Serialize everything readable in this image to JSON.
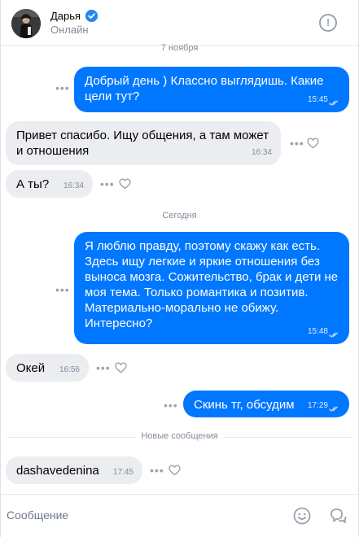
{
  "header": {
    "name": "Дарья",
    "status": "Онлайн",
    "info_icon": "!"
  },
  "dates": {
    "first": "7 ноября",
    "second": "Сегодня"
  },
  "messages": [
    {
      "dir": "out",
      "text_lines": [
        "Добрый день ) Классно выглядишь. Какие",
        "цели тут?"
      ],
      "time": "15:45",
      "read": true
    },
    {
      "dir": "in",
      "text_lines": [
        "Привет спасибо. Ищу общения, а там может",
        "и отношения"
      ],
      "time": "16:34"
    },
    {
      "dir": "in",
      "text_lines": [
        "А ты?"
      ],
      "time": "16:34"
    },
    {
      "dir": "out",
      "text_lines": [
        "Я люблю правду, поэтому скажу как есть.",
        "Здесь ищу легкие и яркие отношения без",
        "выноса мозга. Сожительство, брак и дети не",
        "моя тема. Только романтика и позитив.",
        "Материально-морально не обижу.",
        "Интересно?"
      ],
      "time": "15:48",
      "read": true
    },
    {
      "dir": "in",
      "text_lines": [
        "Окей"
      ],
      "time": "16:56"
    },
    {
      "dir": "out",
      "text_lines": [
        "Скинь тг, обсудим"
      ],
      "time": "17:29",
      "read": true
    },
    {
      "dir": "in",
      "text_lines": [
        "dashavedenina"
      ],
      "time": "17:45"
    }
  ],
  "new_messages_label": "Новые сообщения",
  "composer": {
    "placeholder": "Сообщение"
  },
  "colors": {
    "accent": "#0077ff",
    "incoming": "#ebedf0",
    "muted": "#818c99"
  },
  "icons": {
    "more": "more-dots-icon",
    "like": "heart-icon",
    "emoji": "smile-icon",
    "voice": "chat-bubbles-icon"
  }
}
